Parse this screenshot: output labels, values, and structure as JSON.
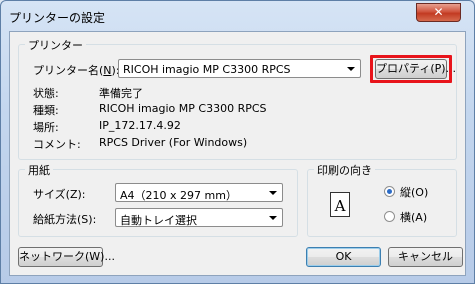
{
  "window": {
    "title": "プリンターの設定",
    "close_glyph": "✕"
  },
  "printer_group": {
    "legend": "プリンター",
    "name_label": "プリンター名(",
    "name_label_key": "N",
    "name_label_end": "):",
    "printer_name": "RICOH imagio MP C3300 RPCS",
    "properties_button": "プロパティ(P)...",
    "status_label": "状態:",
    "status_value": "準備完了",
    "type_label": "種類:",
    "type_value": "RICOH imagio MP C3300 RPCS",
    "location_label": "場所:",
    "location_value": "IP_172.17.4.92",
    "comment_label": "コメント:",
    "comment_value": "RPCS Driver (For Windows)"
  },
  "paper_group": {
    "legend": "用紙",
    "size_label": "サイズ(Z):",
    "size_value": "A4（210 x 297 mm）",
    "source_label": "給紙方法(S):",
    "source_value": "自動トレイ選択"
  },
  "orientation_group": {
    "legend": "印刷の向き",
    "portrait_label": "縦(O)",
    "landscape_label": "横(A)",
    "selected": "portrait",
    "icon_letter": "A"
  },
  "buttons": {
    "network": "ネットワーク(W)...",
    "ok": "OK",
    "cancel": "キャンセル"
  },
  "colors": {
    "highlight": "#e8141b"
  }
}
